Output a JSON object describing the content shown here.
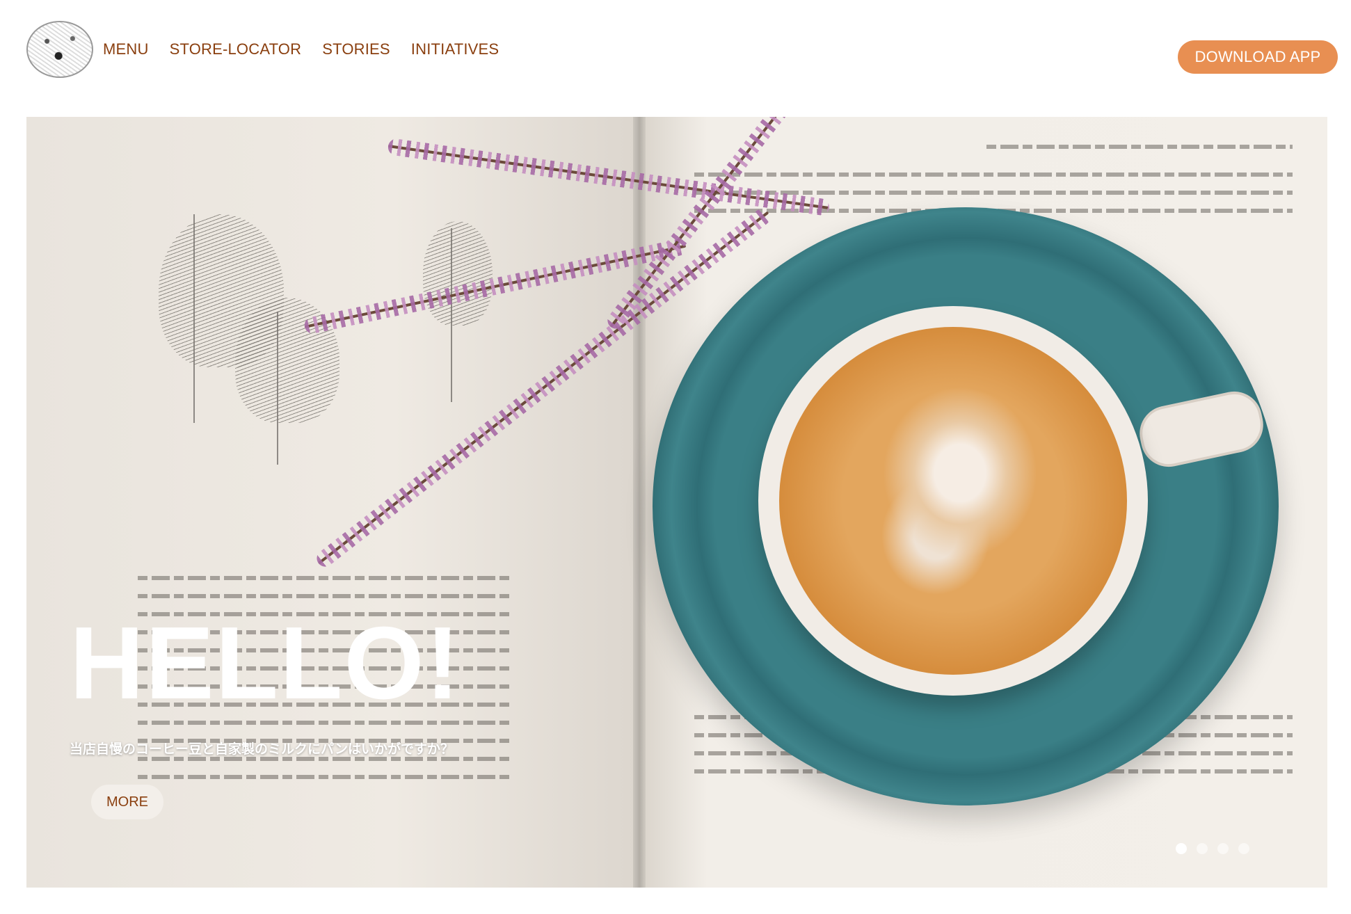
{
  "header": {
    "nav": [
      "MENU",
      "STORE-LOCATOR",
      "STORIES",
      "INITIATIVES"
    ],
    "download_label": "DOWNLOAD APP"
  },
  "hero": {
    "title": "HELLO!",
    "subtitle": "当店自慢のコーヒー豆と自家製のミルクにパンはいかがですか？",
    "more_label": "MORE",
    "slides_total": 4,
    "active_slide": 1
  },
  "colors": {
    "nav_text": "#8a3f0f",
    "download_button": "#e88f52",
    "hero_text": "#ffffff"
  },
  "icons": {
    "logo": "illustrated-round-logo"
  }
}
